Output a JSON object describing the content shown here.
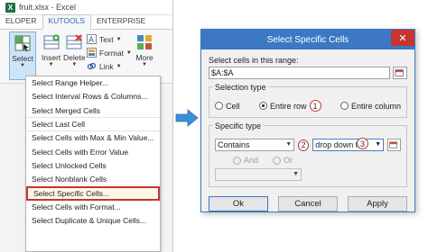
{
  "excel": {
    "title": "fruit.xlsx - Excel",
    "tabs": [
      "ELOPER",
      "KUTOOLS",
      "ENTERPRISE"
    ],
    "active_tab": "KUTOOLS",
    "buttons": {
      "select": "Select",
      "insert": "Insert",
      "delete": "Delete",
      "more": "More"
    },
    "small_items": [
      "Text",
      "Format",
      "Link"
    ],
    "menu_items": [
      "Select Range Helper...",
      "Select Interval Rows & Columns...",
      "Select Merged Cells",
      "Select Last Cell",
      "Select Cells with Max & Min Value...",
      "Select Cells with Error Value",
      "Select Unlocked Cells",
      "Select Nonblank Cells",
      "Select Specific Cells...",
      "Select Cells with Format...",
      "Select Duplicate & Unique Cells..."
    ]
  },
  "dialog": {
    "title": "Select Specific Cells",
    "close": "✕",
    "range_label": "Select cells in this range:",
    "range_value": "$A:$A",
    "selection_type_title": "Selection type",
    "radio_cell": "Cell",
    "radio_entire_row": "Entire row",
    "radio_entire_column": "Entire column",
    "specific_type_title": "Specific type",
    "condition": "Contains",
    "value": "drop down list",
    "and_label": "And",
    "or_label": "Or",
    "ok": "Ok",
    "cancel": "Cancel",
    "apply": "Apply",
    "badges": [
      "1",
      "2",
      "3"
    ]
  },
  "colors": {
    "accent": "#3c78c3",
    "highlight": "#c0392b",
    "arrow": "#3d8fd6"
  }
}
